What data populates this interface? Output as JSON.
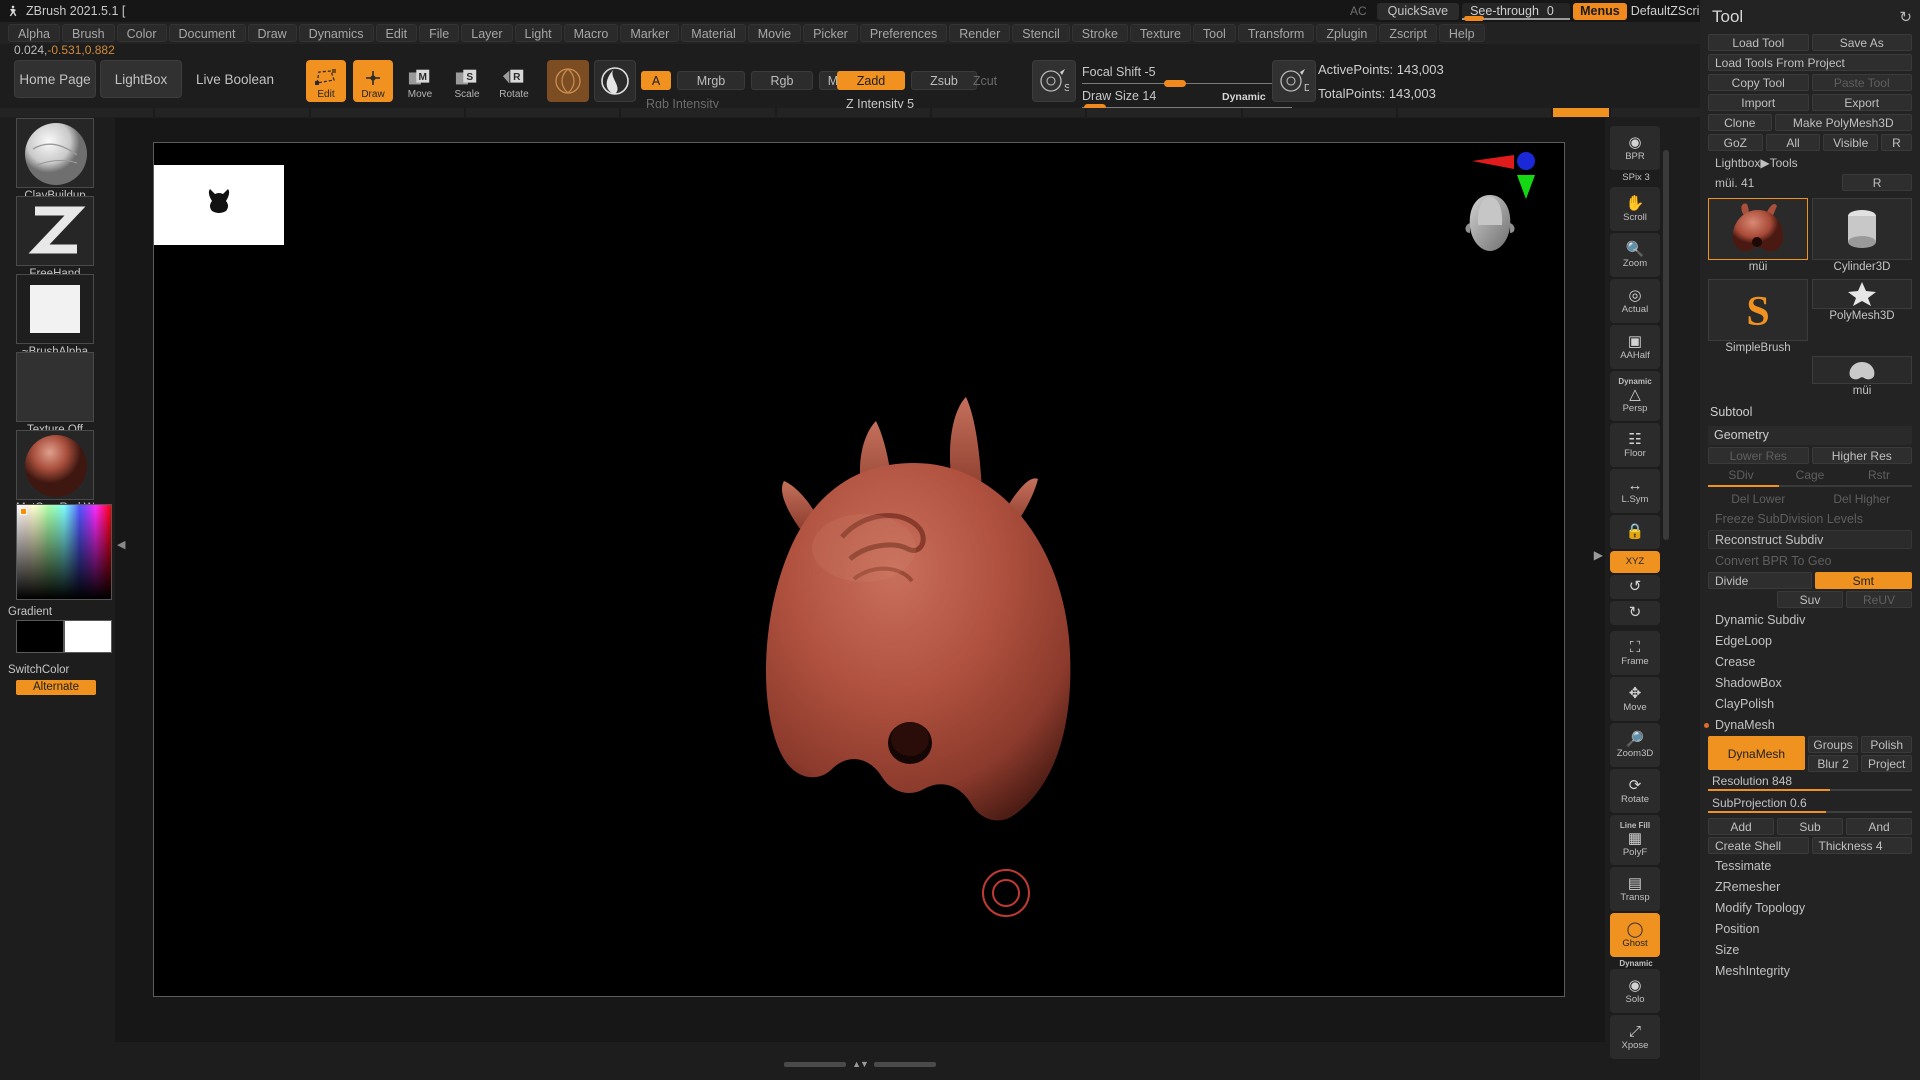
{
  "titlebar": {
    "app_title": "ZBrush 2021.5.1 [",
    "ac": "AC",
    "quicksave": "QuickSave",
    "see_through_label": "See-through",
    "see_through_value": "0",
    "menus": "Menus",
    "default_zscript": "DefaultZScript",
    "accent": "#f0921f"
  },
  "menubar": {
    "items": [
      "Alpha",
      "Brush",
      "Color",
      "Document",
      "Draw",
      "Dynamics",
      "Edit",
      "File",
      "Layer",
      "Light",
      "Macro",
      "Marker",
      "Material",
      "Movie",
      "Picker",
      "Preferences",
      "Render",
      "Stencil",
      "Stroke",
      "Texture",
      "Tool",
      "Transform",
      "Zplugin",
      "Zscript",
      "Help"
    ]
  },
  "coord_readout": {
    "x": "0.024,",
    "y": "-0.531,",
    "z": "0.882"
  },
  "shelf": {
    "home_page": "Home Page",
    "lightbox": "LightBox",
    "live_boolean": "Live Boolean",
    "modes": [
      {
        "label": "Edit",
        "icon": "edit-icon",
        "active": true
      },
      {
        "label": "Draw",
        "icon": "draw-icon",
        "active": true
      },
      {
        "label": "Move",
        "icon": "move-icon",
        "active": false
      },
      {
        "label": "Scale",
        "icon": "scale-icon",
        "active": false
      },
      {
        "label": "Rotate",
        "icon": "rotate-icon",
        "active": false
      }
    ],
    "material_swatch": "material-sphere-icon",
    "material_swatch2": "matcap-sphere-icon",
    "color_mode": [
      {
        "label": "A",
        "active": true
      },
      {
        "label": "Mrgb",
        "active": false
      },
      {
        "label": "Rgb",
        "active": false
      },
      {
        "label": "M",
        "active": false
      }
    ],
    "rgb_intensity_label": "Rgb Intensity",
    "z_mode": [
      {
        "label": "Zadd",
        "active": true,
        "disabled": false
      },
      {
        "label": "Zsub",
        "active": false,
        "disabled": false
      },
      {
        "label": "Zcut",
        "active": false,
        "disabled": true
      }
    ],
    "z_intensity_label": "Z Intensity 5",
    "focal_shift_label": "Focal Shift -5",
    "draw_size_label": "Draw Size 14",
    "dynamic_label": "Dynamic",
    "stroke_icon_s": "S",
    "stroke_icon_d": "D",
    "active_points": "ActivePoints: 143,003",
    "total_points": "TotalPoints: 143,003"
  },
  "leftshelf": {
    "brush": {
      "label": "ClayBuildup",
      "icon": "brush-thumbnail"
    },
    "stroke": {
      "label": "FreeHand",
      "icon": "stroke-thumbnail"
    },
    "alpha": {
      "label": "~BrushAlpha",
      "icon": "alpha-thumbnail"
    },
    "texture": {
      "label": "Texture Off",
      "icon": "texture-thumbnail"
    },
    "material": {
      "label": "MatCap Red Wax",
      "icon": "material-thumbnail"
    },
    "gradient_label": "Gradient",
    "switchcolor_label": "SwitchColor",
    "alternate_label": "Alternate",
    "main_color": "#000000",
    "secondary_color": "#ffffff"
  },
  "canvas": {
    "document_thumb": "document-thumbnail",
    "model_color": "#b0513f",
    "gizmo": {
      "x_axis": "#e02020",
      "y_axis": "#16d016",
      "z_axis": "#2030e0"
    },
    "brush_cursor_color": "#c03a33"
  },
  "rightnav": {
    "items": [
      {
        "label": "BPR",
        "icon": "bpr-render-icon",
        "active": false
      },
      {
        "label": "SPix 3",
        "icon": "spix-value",
        "is_value": true
      },
      {
        "label": "Scroll",
        "icon": "scroll-icon",
        "active": false
      },
      {
        "label": "Zoom",
        "icon": "zoom-icon",
        "active": false
      },
      {
        "label": "Actual",
        "icon": "actual-size-icon",
        "active": false
      },
      {
        "label": "AAHalf",
        "icon": "aahalf-icon",
        "active": false
      },
      {
        "label": "Persp",
        "icon": "perspective-icon",
        "active": false,
        "top": "Dynamic"
      },
      {
        "label": "Floor",
        "icon": "floor-grid-icon",
        "active": false
      },
      {
        "label": "L.Sym",
        "icon": "local-symmetry-icon",
        "active": false
      },
      {
        "label": "",
        "icon": "lock-icon",
        "active": false
      },
      {
        "label": "XYZ",
        "icon": "xyz-icon",
        "active": true
      },
      {
        "label": "",
        "icon": "rotate-ccw-icon",
        "active": false
      },
      {
        "label": "",
        "icon": "rotate-cw-icon",
        "active": false
      },
      {
        "label": "Frame",
        "icon": "frame-icon",
        "active": false
      },
      {
        "label": "Move",
        "icon": "move-nav-icon",
        "active": false
      },
      {
        "label": "Zoom3D",
        "icon": "zoom3d-icon",
        "active": false
      },
      {
        "label": "Rotate",
        "icon": "rotate-nav-icon",
        "active": false
      },
      {
        "label": "PolyF",
        "icon": "polyframe-icon",
        "active": false,
        "top": "Line Fill"
      },
      {
        "label": "Transp",
        "icon": "transparency-icon",
        "active": false
      },
      {
        "label": "Ghost",
        "icon": "ghost-icon",
        "active": true,
        "bottom": "Dynamic"
      },
      {
        "label": "Solo",
        "icon": "solo-icon",
        "active": false
      },
      {
        "label": "Xpose",
        "icon": "xpose-icon",
        "active": false
      }
    ]
  },
  "toolpanel": {
    "title": "Tool",
    "reload_icon": "reload-icon",
    "rows": [
      [
        {
          "label": "Load Tool"
        },
        {
          "label": "Save As"
        }
      ],
      [
        {
          "label": "Load Tools From Project",
          "wide": true
        }
      ],
      [
        {
          "label": "Copy Tool"
        },
        {
          "label": "Paste Tool",
          "disabled": true
        }
      ],
      [
        {
          "label": "Import"
        },
        {
          "label": "Export"
        }
      ],
      [
        {
          "label": "Clone"
        },
        {
          "label": "Make PolyMesh3D"
        }
      ],
      [
        {
          "label": "GoZ"
        },
        {
          "label": "All"
        },
        {
          "label": "Visible"
        },
        {
          "label": "R",
          "small": true
        }
      ],
      [
        {
          "label": "Lightbox▶Tools",
          "wide": true
        }
      ],
      [
        {
          "label": "müi. 41",
          "wide": true
        },
        {
          "label": "R",
          "small": true
        }
      ]
    ],
    "tools": [
      {
        "label": "müi",
        "selected": true,
        "icon": "mui-head-thumbnail"
      },
      {
        "label": "Cylinder3D",
        "selected": false,
        "icon": "cylinder3d-thumbnail"
      },
      {
        "label": "SimpleBrush",
        "selected": false,
        "icon": "simplebrush-thumbnail"
      },
      {
        "label": "PolyMesh3D",
        "selected": false,
        "icon": "polymesh3d-thumbnail"
      },
      {
        "label": "müi",
        "selected": false,
        "icon": "mui-thumbnail"
      }
    ],
    "subtool_header": "Subtool",
    "geometry_header": "Geometry",
    "geometry": {
      "lower_res": "Lower Res",
      "higher_res": "Higher Res",
      "sdiv": "SDiv",
      "cage": "Cage",
      "rstr": "Rstr",
      "del_lower": "Del Lower",
      "del_higher": "Del Higher",
      "freeze_subdivision": "Freeze SubDivision Levels",
      "reconstruct_subdiv": "Reconstruct Subdiv",
      "convert_bpr": "Convert BPR To Geo",
      "divide": "Divide",
      "smt": "Smt",
      "suv": "Suv",
      "reuv": "ReUV",
      "dynamic_subdiv": "Dynamic Subdiv",
      "edgeloop": "EdgeLoop",
      "crease": "Crease",
      "shadowbox": "ShadowBox",
      "claypolish": "ClayPolish"
    },
    "dynamesh": {
      "header": "DynaMesh",
      "button": "DynaMesh",
      "groups": "Groups",
      "polish": "Polish",
      "blur": "Blur 2",
      "project": "Project",
      "resolution": "Resolution 848",
      "subprojection": "SubProjection 0.6",
      "add": "Add",
      "sub": "Sub",
      "and": "And",
      "create_shell": "Create Shell",
      "thickness": "Thickness 4"
    },
    "bottom_items": [
      "Tessimate",
      "ZRemesher",
      "Modify Topology",
      "Position",
      "Size",
      "MeshIntegrity"
    ]
  }
}
